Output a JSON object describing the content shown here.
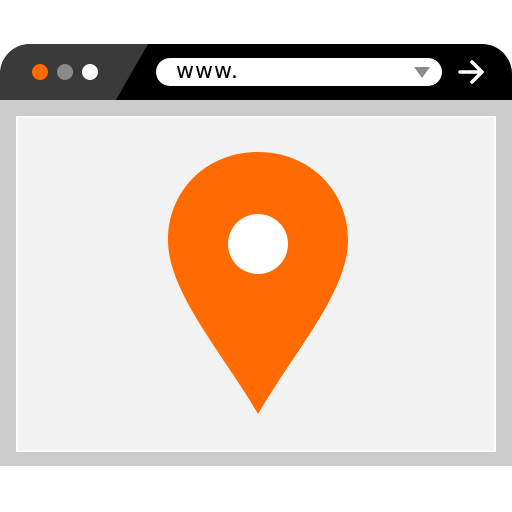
{
  "window": {
    "title_bar": {
      "controls": [
        {
          "name": "close-dot",
          "color": "#ff6b00"
        },
        {
          "name": "minimize-dot",
          "color": "#8a8a8a"
        },
        {
          "name": "maximize-dot",
          "color": "#ffffff"
        }
      ]
    },
    "address_bar": {
      "value": "www.",
      "dropdown_icon": "chevron-down-icon"
    },
    "go_button_icon": "arrow-right-icon",
    "content": {
      "icon": "location-pin-icon"
    }
  },
  "colors": {
    "accent": "#ff6b00",
    "titlebar": "#000000",
    "titlebar_left": "#3a3a3a",
    "frame": "#cccccc",
    "viewport_bg": "#f2f2f2"
  }
}
